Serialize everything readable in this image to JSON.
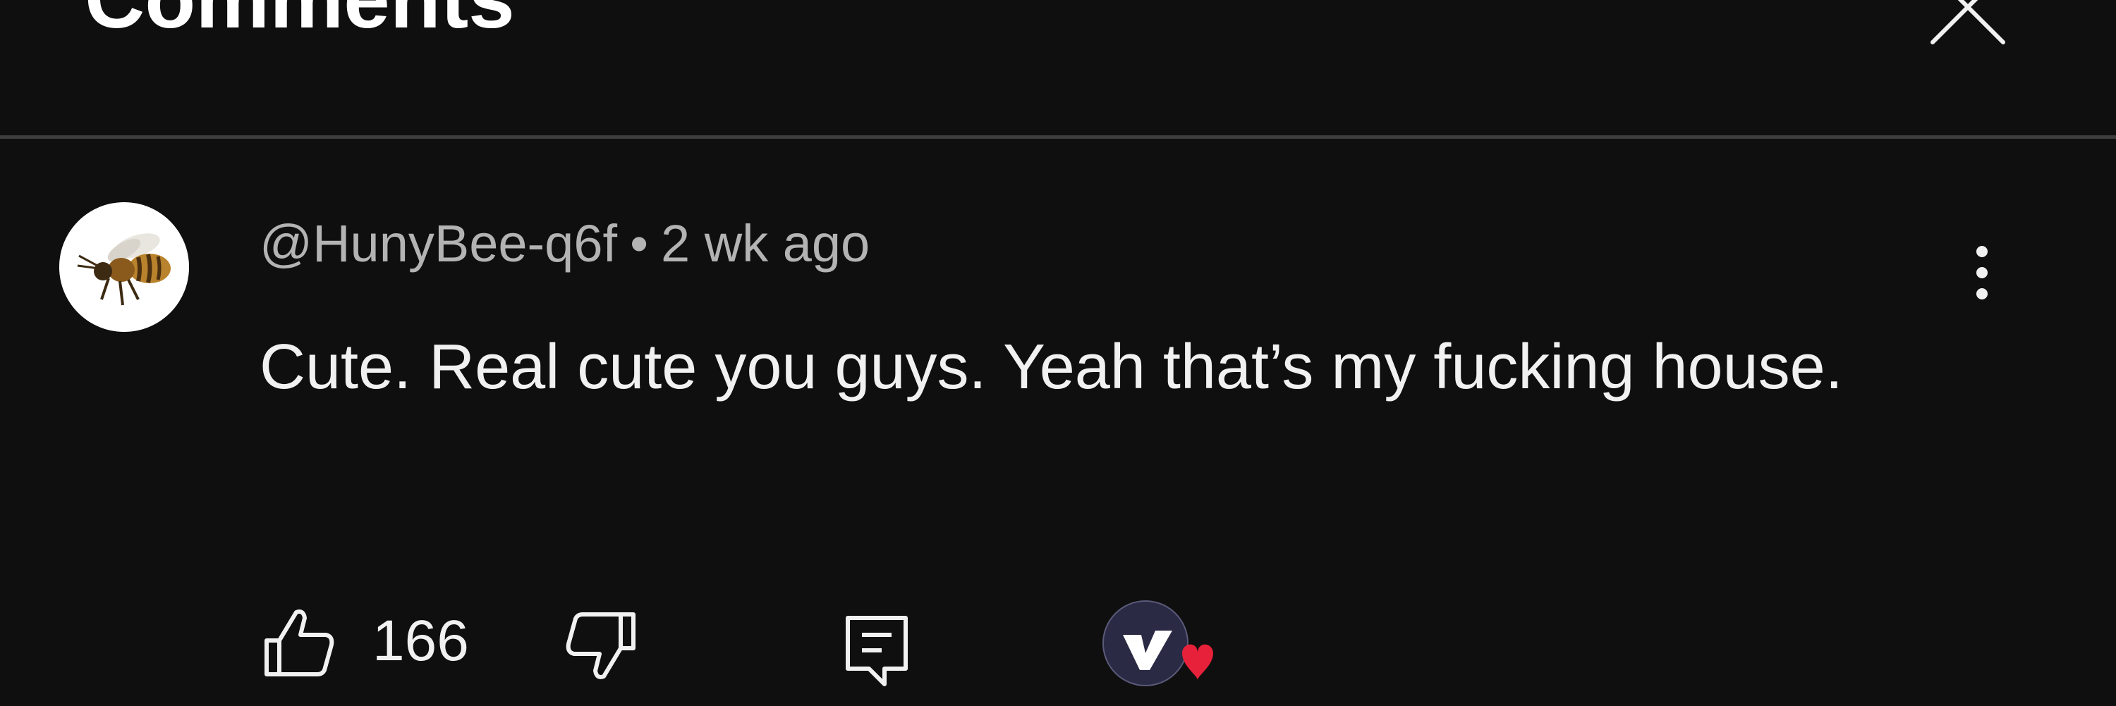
{
  "header": {
    "title": "Comments"
  },
  "comment": {
    "author": "@HunyBee-q6f",
    "separator": "•",
    "time": "2 wk ago",
    "text": "Cute. Real cute you guys. Yeah that’s my fucking house.",
    "like_count": "166"
  },
  "icons": {
    "close": "close-icon",
    "more": "more-vert-icon",
    "like": "thumbs-up-icon",
    "dislike": "thumbs-down-icon",
    "reply": "reply-comment-icon",
    "creator_heart": "creator-heart-icon"
  },
  "colors": {
    "background": "#0f0f0f",
    "text_primary": "#f1f1f1",
    "text_secondary": "#b3b3b3",
    "heart": "#e8213a"
  }
}
